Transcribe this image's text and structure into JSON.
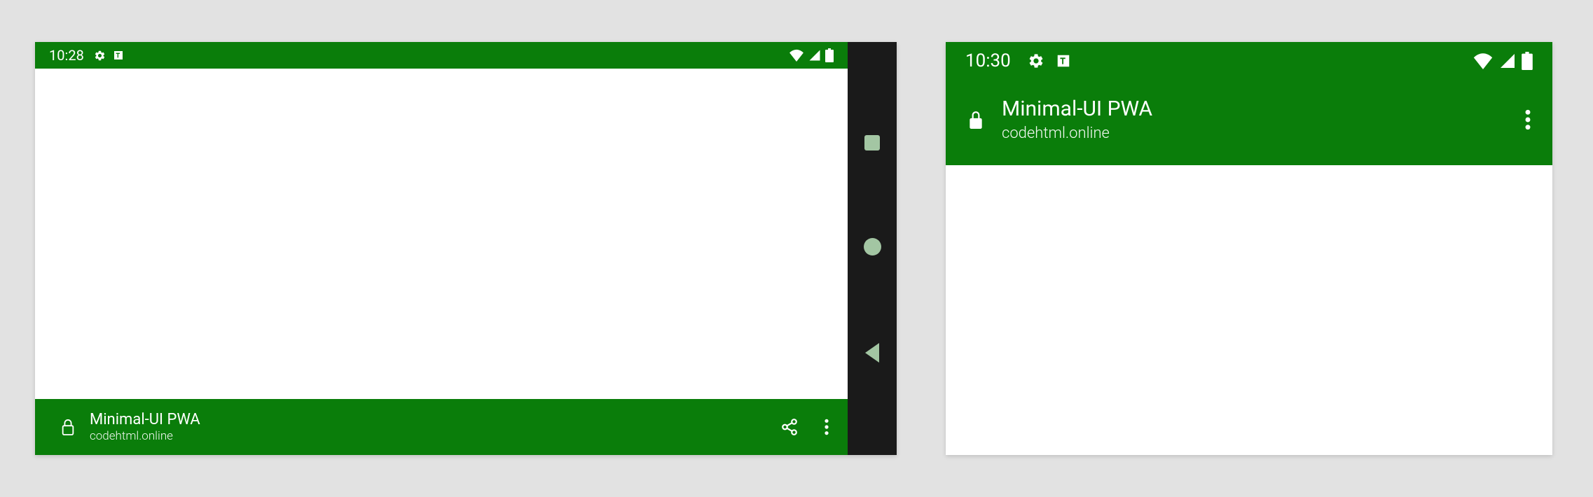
{
  "colors": {
    "theme": "#0a7d0a",
    "navbar": "#1a1a1a",
    "navicons": "#a3c6a3",
    "bg": "#e2e2e2"
  },
  "left": {
    "status_time": "10:28",
    "app_title": "Minimal-UI PWA",
    "app_origin": "codehtml.online"
  },
  "right": {
    "status_time": "10:30",
    "app_title": "Minimal-UI PWA",
    "app_origin": "codehtml.online"
  }
}
